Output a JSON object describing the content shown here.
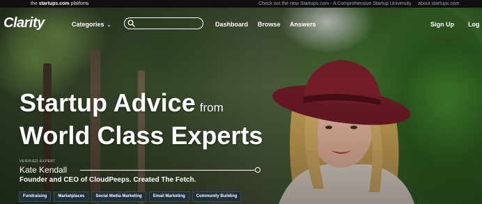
{
  "platform_bar": {
    "brand_prefix": "the",
    "brand_name": "startups.com",
    "brand_suffix": "platform",
    "promo_text": "Check out the new Startups.com - A Comprehensive Startup University",
    "about_link": "about startups.com"
  },
  "nav": {
    "logo": "Clarity",
    "categories_label": "Categories",
    "search_placeholder": "",
    "dashboard_label": "Dashboard",
    "browse_label": "Browse",
    "answers_label": "Answers",
    "signup_label": "Sign Up",
    "login_label": "Log"
  },
  "hero": {
    "headline_line1": "Startup Advice",
    "headline_from": "from",
    "headline_line2": "World Class Experts",
    "verified_label": "VERIFIED EXPERT",
    "expert_name": "Kate Kendall",
    "expert_bio": "Founder and CEO of CloudPeeps. Created The Fetch.",
    "tags": [
      "Fundraising",
      "Marketplaces",
      "Social Media Marketing",
      "Email Marketing",
      "Community Building"
    ]
  },
  "colors": {
    "platform_bar_bg": "#0f0f12",
    "tag_bg": "#22303b",
    "hat": "#7a1f2b"
  },
  "icons": {
    "search": "search-icon",
    "categories_caret": "chevron-down-icon",
    "platform_caret": "chevron-down-icon"
  }
}
